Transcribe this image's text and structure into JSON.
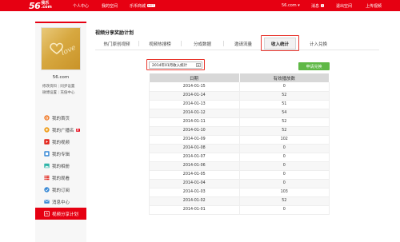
{
  "header": {
    "logo_num": "56",
    "logo_suffix": ".com",
    "logo_name": "我乐",
    "nav_left": [
      "个人中心",
      "我的空间",
      "乐币商城"
    ],
    "hot_badge": "HOT",
    "nav_right": [
      "56.com ▾",
      "消息",
      "退出空间",
      "上传视频"
    ],
    "message_count": "1"
  },
  "sidebar": {
    "username": "56.com",
    "profile_links": [
      "修改资料",
      "同步设置",
      "微博设置",
      "充值中心"
    ],
    "menu": [
      {
        "label": "我的首页",
        "icon": "home-icon",
        "color": "#f07c2c"
      },
      {
        "label": "我的广播名",
        "icon": "broadcast-icon",
        "color": "#f0a020",
        "badge": "新"
      },
      {
        "label": "我的视频",
        "icon": "video-icon",
        "color": "#e2231a"
      },
      {
        "label": "我的专辑",
        "icon": "album-icon",
        "color": "#3a8ad6"
      },
      {
        "label": "我的相册",
        "icon": "photo-icon",
        "color": "#2fb4a8"
      },
      {
        "label": "我的观看",
        "icon": "watch-icon",
        "color": "#e2231a"
      },
      {
        "label": "我的订阅",
        "icon": "subscribe-icon",
        "color": "#3a8ad6"
      },
      {
        "label": "消息中心",
        "icon": "message-icon",
        "color": "#3a8ad6"
      },
      {
        "label": "视频分享计划",
        "icon": "share-plan-icon",
        "color": "#ffffff",
        "active": true
      }
    ]
  },
  "main": {
    "title": "视频分享奖励计划",
    "tabs": [
      "热门原创视频",
      "视频热搜榜",
      "分成数据",
      "邀请流量",
      "收入统计",
      "计入兑换"
    ],
    "active_tab": 4,
    "select_value": "2014年01月收入统计",
    "exchange_button": "申请兑换",
    "table_headers": [
      "日期",
      "有效播放数"
    ],
    "rows": [
      [
        "2014-01-15",
        "0"
      ],
      [
        "2014-01-14",
        "52"
      ],
      [
        "2014-01-13",
        "51"
      ],
      [
        "2014-01-12",
        "54"
      ],
      [
        "2014-01-11",
        "52"
      ],
      [
        "2014-01-10",
        "52"
      ],
      [
        "2014-01-09",
        "102"
      ],
      [
        "2014-01-08",
        "0"
      ],
      [
        "2014-01-07",
        "0"
      ],
      [
        "2014-01-06",
        "0"
      ],
      [
        "2014-01-05",
        "0"
      ],
      [
        "2014-01-04",
        "0"
      ],
      [
        "2014-01-03",
        "103"
      ],
      [
        "2014-01-02",
        "52"
      ],
      [
        "2014-01-01",
        "0"
      ]
    ]
  },
  "colors": {
    "brand_red": "#e60012",
    "button_green": "#5fb846",
    "highlight_red": "#e8372e"
  }
}
